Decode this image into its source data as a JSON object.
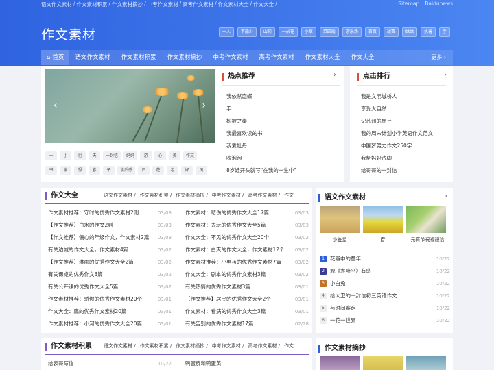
{
  "top": {
    "crumbs": [
      "语文作文素材",
      "作文素材积累",
      "作文素材摘抄",
      "中考作文素材",
      "高考作文素材",
      "作文素材大全",
      "作文大全"
    ],
    "sep": "/",
    "links": [
      "Sitemap",
      "Baidunews"
    ]
  },
  "logo": "作文素材",
  "tags": [
    "一人",
    "不能少",
    "山药",
    "一朵花",
    "小草",
    "菜園殿",
    "游乐场",
    "首页",
    "球赛",
    "姑姑",
    "执着",
    "手"
  ],
  "nav": {
    "items": [
      "首页",
      "语文作文素材",
      "作文素材积累",
      "作文素材摘抄",
      "中考作文素材",
      "高考作文素材",
      "作文素材大全",
      "作文大全"
    ],
    "more": "更多"
  },
  "keywords": [
    [
      "一",
      "小",
      "也",
      "天",
      "一封信",
      "妈妈",
      "游",
      "心",
      "美",
      "作文"
    ],
    [
      "书",
      "家",
      "想",
      "春",
      "子",
      "读后感",
      "日",
      "花",
      "老",
      "好",
      "风"
    ]
  ],
  "hot": {
    "title": "热点推荐",
    "items": [
      "我依然恋蝶",
      "手",
      "松坡之奉",
      "我最喜欢读的书",
      "我爱牡丹",
      "吹泡泡",
      "8岁娃开头就写\"在我的一生中\""
    ]
  },
  "click": {
    "title": "点击排行",
    "items": [
      "我是文明城桥人",
      "享受大自然",
      "记苏州的虎丘",
      "我的周末计划小学英语作文范文",
      "中国梦努力作文250字",
      "我帮妈妈洗脚",
      "给哥哥的一封信"
    ]
  },
  "daquan": {
    "title": "作文大全",
    "tabs": [
      "语文作文素材 /",
      "作文素材积累 /",
      "作文素材摘抄 /",
      "中考作文素材 /",
      "高考作文素材 /",
      "作文"
    ],
    "left": [
      {
        "t": "作文素材推荐：守时的优秀作文素材2则",
        "d": "03/03"
      },
      {
        "t": "【作文推荐】白水的作文2则",
        "d": "03/03"
      },
      {
        "t": "【作文推荐】偏心的年级作文，作文素材2篇",
        "d": "03/03"
      },
      {
        "t": "有关边城的作文大全，作文素材4篇",
        "d": "03/02"
      },
      {
        "t": "【作文推荐】淋雨的优秀作文大全2篇",
        "d": "03/02"
      },
      {
        "t": "有关课桌的优秀作文3篇",
        "d": "03/02"
      },
      {
        "t": "有关公开课的优秀作文大全5篇",
        "d": "03/02"
      },
      {
        "t": "作文素材推荐：骄傲的优秀作文素材20个",
        "d": "03/01"
      },
      {
        "t": "作文大全：鹰的优秀作文素材20篇",
        "d": "03/01"
      },
      {
        "t": "作文素材推荐：小河的优秀作文大全20篇",
        "d": "03/01"
      }
    ],
    "right": [
      {
        "t": "作文素材：悲伤的优秀作文大全17篇",
        "d": "03/03"
      },
      {
        "t": "作文素材：去玩的优秀作文大全5篇",
        "d": "03/03"
      },
      {
        "t": "作文大全：不见的优秀作文大全20个",
        "d": "03/02"
      },
      {
        "t": "作文素材：白天的作文大全，作文素材12个",
        "d": "03/02"
      },
      {
        "t": "作文素材推荐：小男孩的优秀作文素材7篇",
        "d": "03/02"
      },
      {
        "t": "作文大全：剧本的优秀作文素材3篇",
        "d": "03/02"
      },
      {
        "t": "有关热情的优秀作文素材3篇",
        "d": "03/01"
      },
      {
        "t": "【作文推荐】居民的优秀作文大全2个",
        "d": "03/01"
      },
      {
        "t": "作文素材：看病的优秀作文大全3篇",
        "d": "03/01"
      },
      {
        "t": "有关告别的优秀作文素材17篇",
        "d": "02/28"
      }
    ]
  },
  "yuwen": {
    "title": "语文作文素材",
    "thumbs": [
      "小鉴星",
      "春",
      "元宵节祝福短信"
    ],
    "rank": [
      {
        "n": "1",
        "t": "花瓣中的童年",
        "d": "10/22",
        "c": "#2d5fd8"
      },
      {
        "n": "2",
        "t": "观《袁隆平》有感",
        "d": "10/22",
        "c": "#3b3b8f"
      },
      {
        "n": "3",
        "t": "小白兔",
        "d": "10/22",
        "c": "#c0712b"
      },
      {
        "n": "4",
        "t": "给大卫的一封信初三英语作文",
        "d": "10/22",
        "c": "#fff"
      },
      {
        "n": "5",
        "t": "与时间赛跑",
        "d": "10/22",
        "c": "#fff"
      },
      {
        "n": "6",
        "t": "一花一世界",
        "d": "10/22",
        "c": "#fff"
      }
    ]
  },
  "jilei": {
    "title": "作文素材积累",
    "tabs": [
      "语文作文素材 /",
      "作文素材积累 /",
      "作文素材摘抄 /",
      "中考作文素材 /",
      "高考作文素材 /",
      "作文"
    ],
    "left": [
      {
        "t": "给表哥写信",
        "d": "10/22"
      }
    ],
    "right": [
      {
        "t": "鸭蛋皮和鸭蛋黄",
        "d": ""
      }
    ]
  },
  "zhaichao": {
    "title": "作文素材摘抄"
  }
}
